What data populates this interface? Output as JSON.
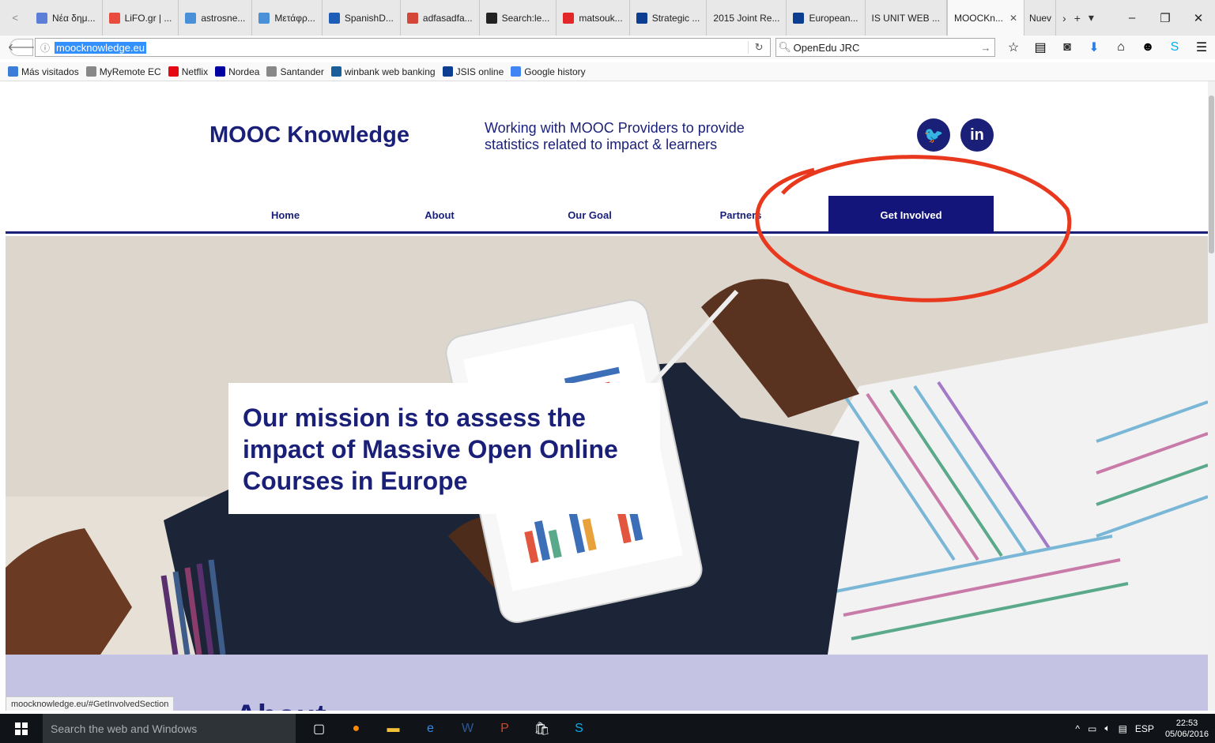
{
  "browser": {
    "tabs": [
      {
        "label": "Νέα δημ...",
        "color": "#5b7fd6"
      },
      {
        "label": "LiFO.gr | ...",
        "color": "#e94b3c"
      },
      {
        "label": "astrosne...",
        "color": "#4a90d9"
      },
      {
        "label": "Μετάφρ...",
        "color": "#4a90d9"
      },
      {
        "label": "SpanishD...",
        "color": "#1c5db8"
      },
      {
        "label": "adfasadfa...",
        "color": "#d44638"
      },
      {
        "label": "Search:le...",
        "color": "#222222"
      },
      {
        "label": "matsouk...",
        "color": "#e2262a"
      },
      {
        "label": "Strategic ...",
        "color": "#0b3d91"
      },
      {
        "label": "2015 Joint Re...",
        "color": ""
      },
      {
        "label": "European...",
        "color": "#0b3d91"
      },
      {
        "label": "IS UNIT WEB ...",
        "color": ""
      }
    ],
    "active_tab": "MOOCKn...",
    "next_tab": "Nuev",
    "url": "moocknowledge.eu",
    "search_engine_text": "OpenEdu JRC",
    "bookmarks": [
      {
        "label": "Más visitados",
        "color": "#3b7dd8"
      },
      {
        "label": "MyRemote EC",
        "color": "#888888"
      },
      {
        "label": "Netflix",
        "color": "#e50914"
      },
      {
        "label": "Nordea",
        "color": "#0000a0"
      },
      {
        "label": "Santander",
        "color": "#888888"
      },
      {
        "label": "winbank web banking",
        "color": "#1a5e9a"
      },
      {
        "label": "JSIS online",
        "color": "#0b3d91"
      },
      {
        "label": "Google history",
        "color": "#4285f4"
      }
    ]
  },
  "site": {
    "brand": "MOOC Knowledge",
    "tagline": "Working with MOOC Providers to provide statistics related to impact & learners",
    "social": [
      {
        "icon": "twitter-icon",
        "glyph": "🐦"
      },
      {
        "icon": "linkedin-icon",
        "glyph": "in"
      }
    ],
    "nav": [
      "Home",
      "About",
      "Our Goal",
      "Partners",
      "Get Involved"
    ],
    "active_nav": "Get Involved",
    "hero_text": "Our mission is to assess the impact of Massive Open Online Courses in Europe",
    "next_section_peek": "About",
    "colors": {
      "brand": "#1a1f78",
      "nav_active": "#13157a",
      "about_band": "#c4c3e3",
      "annotation": "#e8381e"
    }
  },
  "status_bar": "moocknowledge.eu/#GetInvolvedSection",
  "taskbar": {
    "search_placeholder": "Search the web and Windows",
    "language": "ESP",
    "time": "22:53",
    "date": "05/06/2016"
  }
}
